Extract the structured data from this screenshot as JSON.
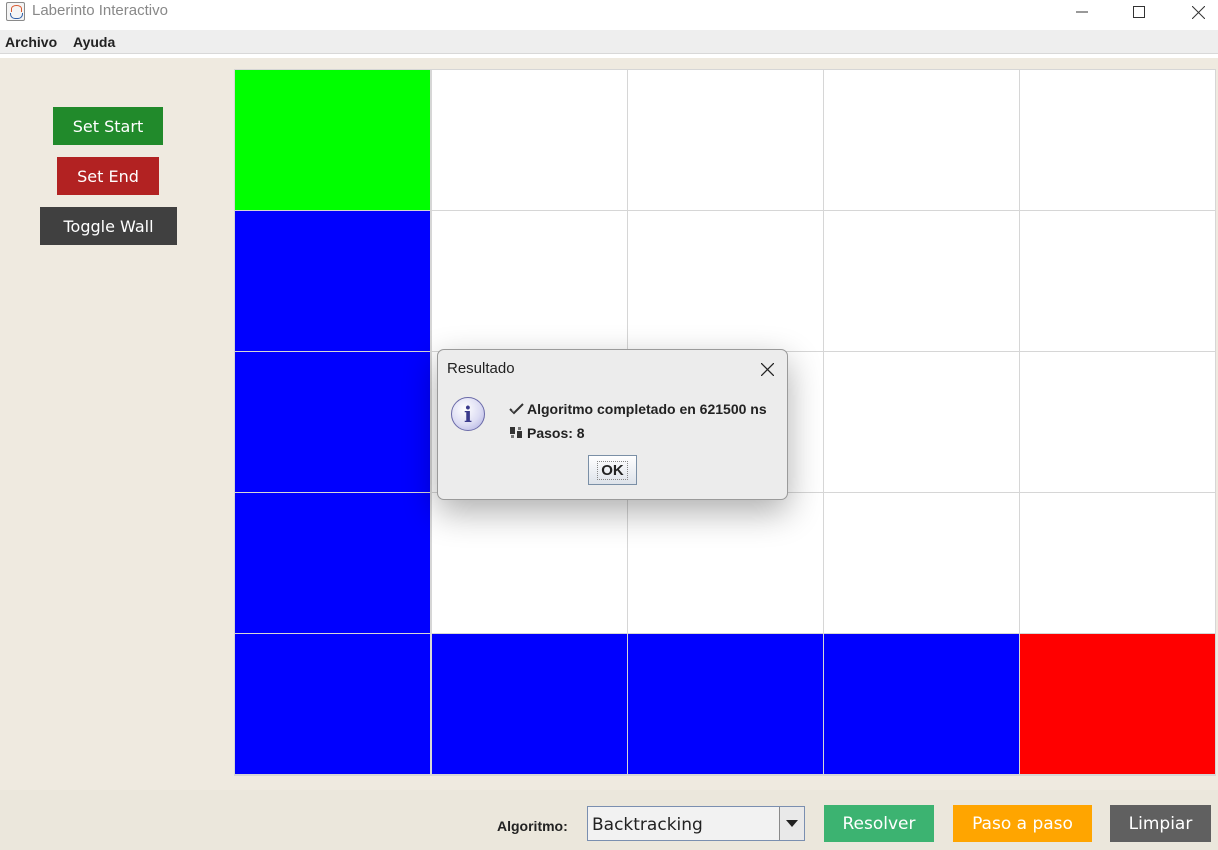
{
  "window": {
    "title": "Laberinto Interactivo"
  },
  "menu": {
    "items": [
      "Archivo",
      "Ayuda"
    ]
  },
  "tools": {
    "set_start": "Set Start",
    "set_end": "Set End",
    "toggle_wall": "Toggle Wall"
  },
  "maze": {
    "rows": 5,
    "cols": 5,
    "legend_colors": {
      "empty": "#ffffff",
      "start": "#00ff00",
      "end": "#ff0000",
      "path": "#0000ff"
    },
    "cells": [
      [
        "start",
        "empty",
        "empty",
        "empty",
        "empty"
      ],
      [
        "path",
        "empty",
        "empty",
        "empty",
        "empty"
      ],
      [
        "path",
        "empty",
        "empty",
        "empty",
        "empty"
      ],
      [
        "path",
        "empty",
        "empty",
        "empty",
        "empty"
      ],
      [
        "path",
        "path",
        "path",
        "path",
        "end"
      ]
    ]
  },
  "controls": {
    "algorithm_label": "Algoritmo:",
    "algorithm_selected": "Backtracking",
    "resolver": "Resolver",
    "paso_a_paso": "Paso a paso",
    "limpiar": "Limpiar"
  },
  "dialog": {
    "title": "Resultado",
    "line1": "Algoritmo completado en 621500 ns",
    "line2": "Pasos: 8",
    "ok": "OK"
  }
}
